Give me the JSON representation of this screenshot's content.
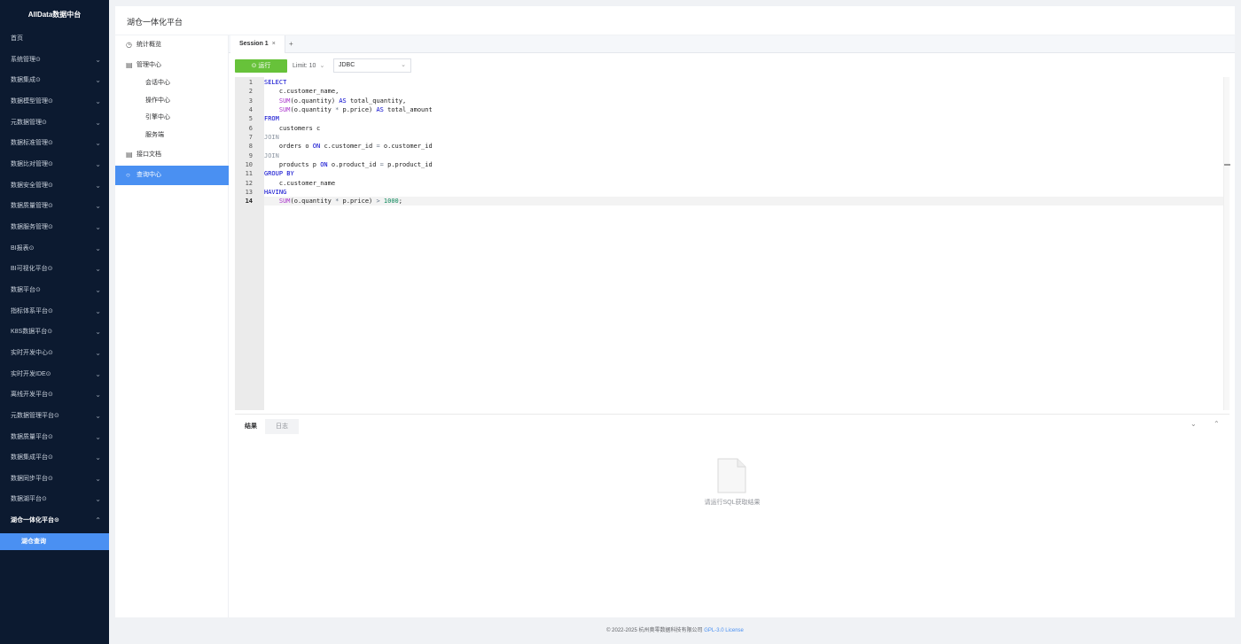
{
  "app": {
    "brand": "AllData数据中台",
    "page_title": "湖仓一体化平台"
  },
  "sidebar": {
    "items": [
      {
        "label": "首页"
      },
      {
        "label": "系统管理⊙"
      },
      {
        "label": "数据集成⊙"
      },
      {
        "label": "数据模型管理⊙"
      },
      {
        "label": "元数据管理⊙"
      },
      {
        "label": "数据标准管理⊙"
      },
      {
        "label": "数据比对管理⊙"
      },
      {
        "label": "数据安全管理⊙"
      },
      {
        "label": "数据质量管理⊙"
      },
      {
        "label": "数据服务管理⊙"
      },
      {
        "label": "BI报表⊙"
      },
      {
        "label": "BI可视化平台⊙"
      },
      {
        "label": "数据平台⊙"
      },
      {
        "label": "指标体系平台⊙"
      },
      {
        "label": "K8S数据平台⊙"
      },
      {
        "label": "实时开发中心⊙"
      },
      {
        "label": "实时开发IDE⊙"
      },
      {
        "label": "离线开发平台⊙"
      },
      {
        "label": "元数据管理平台⊙"
      },
      {
        "label": "数据质量平台⊙"
      },
      {
        "label": "数据集成平台⊙"
      },
      {
        "label": "数据同步平台⊙"
      },
      {
        "label": "数据湖平台⊙"
      },
      {
        "label": "湖仓一体化平台⊙"
      }
    ],
    "sub_item": "湖仓查询"
  },
  "left_menu": {
    "items": [
      {
        "label": "统计概览",
        "icon": "clock-icon"
      },
      {
        "label": "管理中心",
        "icon": "document-icon"
      },
      {
        "label": "接口文档",
        "icon": "document-icon"
      },
      {
        "label": "查询中心",
        "icon": "circle-icon"
      }
    ],
    "sub_items": [
      "会话中心",
      "操作中心",
      "引擎中心",
      "服务端"
    ]
  },
  "tabs": {
    "session": "Session 1",
    "close": "×",
    "add": "+"
  },
  "toolbar": {
    "run": "运行",
    "limit": "Limit: 10",
    "engine": "JDBC"
  },
  "editor": {
    "line_numbers": [
      "1",
      "2",
      "3",
      "4",
      "5",
      "6",
      "7",
      "8",
      "9",
      "10",
      "11",
      "12",
      "13",
      "14"
    ]
  },
  "results": {
    "tab_result": "结果",
    "tab_log": "日志",
    "empty_text": "请运行SQL获取结果"
  },
  "footer": {
    "copyright": "© 2022-2025 杭州奥零数据科技有限公司",
    "license": "GPL-3.0 License"
  },
  "colors": {
    "sidebar_bg": "#0c1a30",
    "accent": "#4a90f2",
    "run_button": "#67c23a"
  }
}
